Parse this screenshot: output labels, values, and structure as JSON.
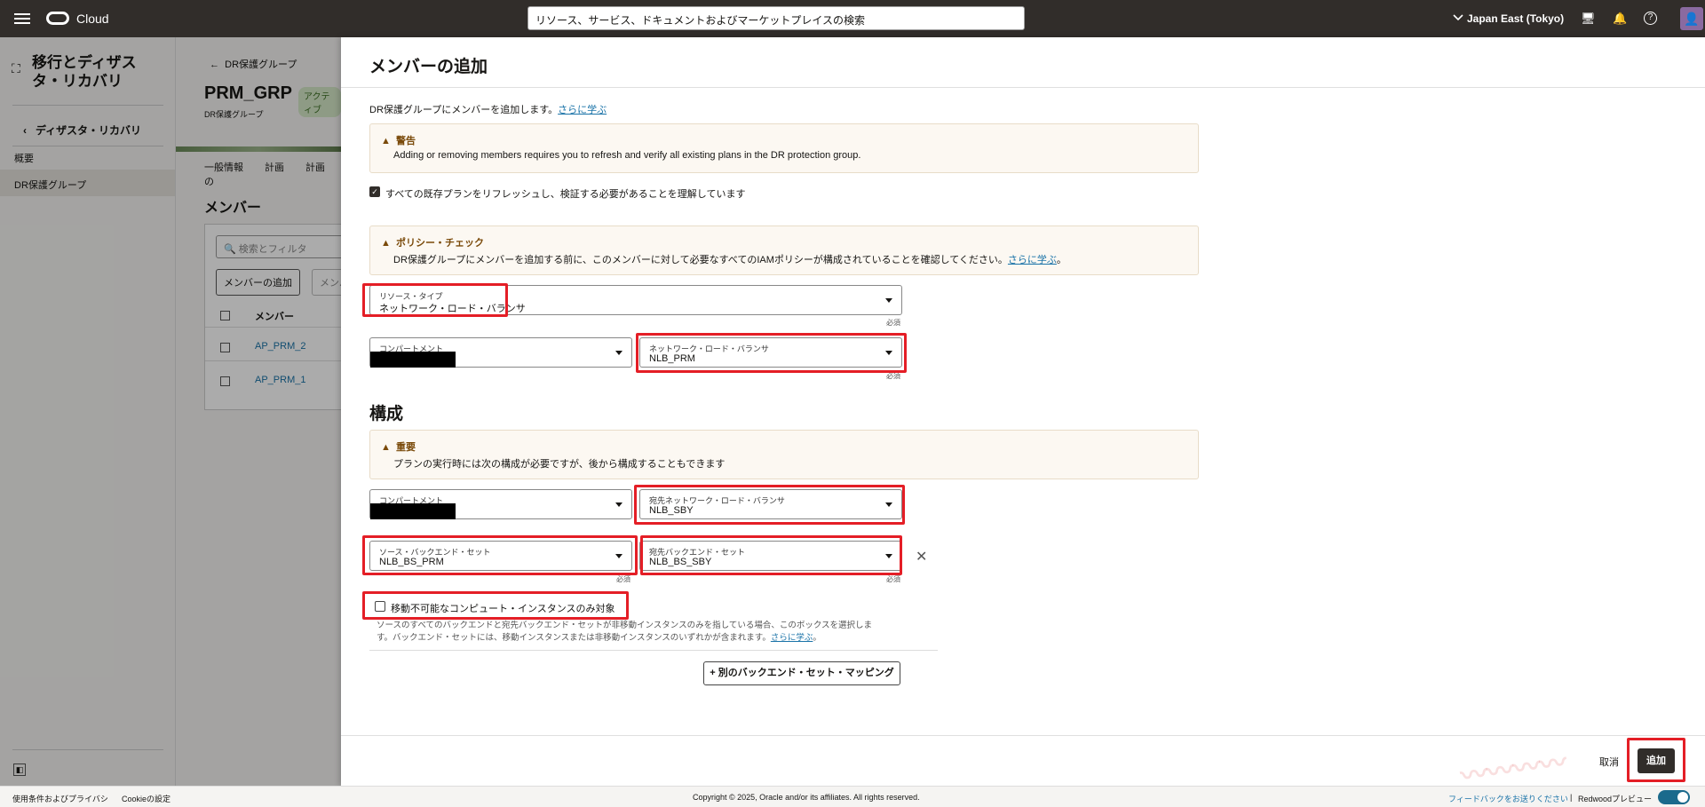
{
  "topbar": {
    "brand": "Cloud",
    "search_placeholder": "リソース、サービス、ドキュメントおよびマーケットプレイスの検索",
    "region": "Japan East (Tokyo)"
  },
  "left_nav": {
    "title": "移行とディザスタ・リカバリ",
    "back_link": "ディザスタ・リカバリ",
    "items": [
      {
        "label": "概要"
      },
      {
        "label": "DR保護グループ"
      }
    ]
  },
  "background_page": {
    "breadcrumb": "DR保護グループ",
    "title": "PRM_GRP",
    "status": "アクティブ",
    "subtitle": "DR保護グループ",
    "tabs": [
      "一般情報",
      "計画",
      "計画の"
    ],
    "section": "メンバー",
    "filter_placeholder": "検索とフィルタ",
    "add_member_button": "メンバーの追加",
    "more_button": "メンバー",
    "column_header": "メンバー",
    "rows": [
      "AP_PRM_2",
      "AP_PRM_1"
    ]
  },
  "panel": {
    "title": "メンバーの追加",
    "intro_text": "DR保護グループにメンバーを追加します。",
    "intro_link": "さらに学ぶ",
    "warning": {
      "title": "警告",
      "text": "Adding or removing members requires you to refresh and verify all existing plans in the DR protection group."
    },
    "acknowledge_label": "すべての既存プランをリフレッシュし、検証する必要があることを理解しています",
    "acknowledge_checked": true,
    "policy": {
      "title": "ポリシー・チェック",
      "text": "DR保護グループにメンバーを追加する前に、このメンバーに対して必要なすべてのIAMポリシーが構成されていることを確認してください。",
      "link": "さらに学ぶ",
      "suffix": "。"
    },
    "resource_type": {
      "label": "リソース・タイプ",
      "value": "ネットワーク・ロード・バランサ"
    },
    "required": "必須",
    "compartment1": {
      "label": "コンパートメント",
      "value": ""
    },
    "nlb": {
      "label": "ネットワーク・ロード・バランサ",
      "value": "NLB_PRM"
    },
    "config_heading": "構成",
    "important": {
      "title": "重要",
      "text": "プランの実行時には次の構成が必要ですが、後から構成することもできます"
    },
    "compartment2": {
      "label": "コンパートメント",
      "value": ""
    },
    "dest_nlb": {
      "label": "宛先ネットワーク・ロード・バランサ",
      "value": "NLB_SBY"
    },
    "source_backend": {
      "label": "ソース・バックエンド・セット",
      "value": "NLB_BS_PRM"
    },
    "dest_backend": {
      "label": "宛先バックエンド・セット",
      "value": "NLB_BS_SBY"
    },
    "nonmovable_label": "移動不可能なコンピュート・インスタンスのみ対象",
    "nonmovable_checked": false,
    "help_text": "ソースのすべてのバックエンドと宛先バックエンド・セットが非移動インスタンスのみを指している場合、このボックスを選択します。バックエンド・セットには、移動インスタンスまたは非移動インスタンスのいずれかが含まれます。",
    "help_link": "さらに学ぶ",
    "help_suffix": "。",
    "mapping_button": "+ 別のバックエンド・セット・マッピング",
    "cancel": "取消",
    "add": "追加"
  },
  "bottombar": {
    "terms": "使用条件およびプライバシ",
    "cookie": "Cookieの設定",
    "copyright": "Copyright © 2025, Oracle and/or its affiliates. All rights reserved.",
    "feedback": "フィードバックをお送りください",
    "separator": "|",
    "redwood": "Redwoodプレビュー"
  }
}
